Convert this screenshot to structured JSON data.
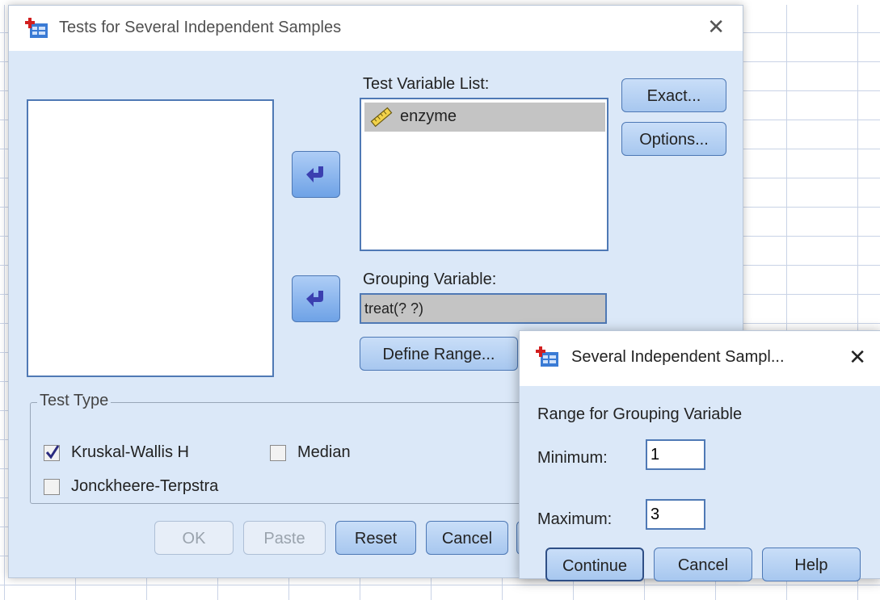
{
  "main_dialog": {
    "title": "Tests for Several Independent Samples",
    "test_variable_list_label": "Test Variable List:",
    "test_variables": [
      "enzyme"
    ],
    "grouping_variable_label": "Grouping Variable:",
    "grouping_variable_value": "treat(? ?)",
    "define_range_label": "Define Range...",
    "exact_label": "Exact...",
    "options_label": "Options...",
    "test_type": {
      "title": "Test Type",
      "kruskal_wallis": {
        "label": "Kruskal-Wallis H",
        "checked": true
      },
      "median": {
        "label": "Median",
        "checked": false
      },
      "jonckheere": {
        "label": "Jonckheere-Terpstra",
        "checked": false
      }
    },
    "buttons": {
      "ok": "OK",
      "paste": "Paste",
      "reset": "Reset",
      "cancel": "Cancel"
    }
  },
  "sub_dialog": {
    "title": "Several Independent Sampl...",
    "section_label": "Range for Grouping Variable",
    "minimum_label": "Minimum:",
    "minimum_value": "1",
    "maximum_label": "Maximum:",
    "maximum_value": "3",
    "buttons": {
      "continue": "Continue",
      "cancel": "Cancel",
      "help": "Help"
    }
  },
  "colors": {
    "dialog_bg": "#dbe8f8",
    "accent_border": "#4f79b5",
    "selection": "#c4c4c4"
  },
  "icons": [
    "app-icon",
    "close-icon",
    "arrow-left-icon",
    "scale-variable-icon",
    "checkbox-check-icon"
  ]
}
